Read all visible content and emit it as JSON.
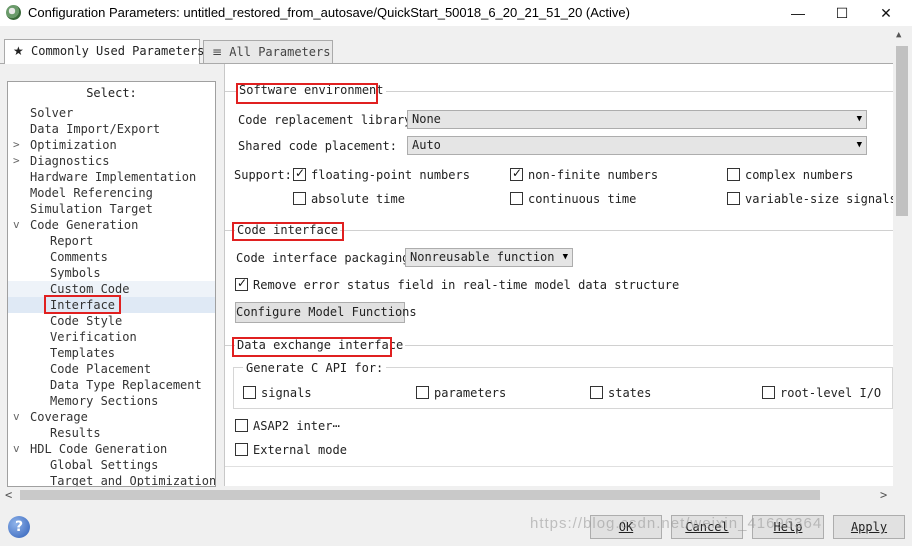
{
  "window": {
    "title": "Configuration Parameters: untitled_restored_from_autosave/QuickStart_50018_6_20_21_51_20 (Active)",
    "minimize": "—",
    "maximize": "☐",
    "close": "✕"
  },
  "tabs": [
    {
      "icon": "★",
      "label": "Commonly Used Parameters"
    },
    {
      "icon": "≡",
      "label": "All Parameters"
    }
  ],
  "tree": {
    "header": "Select:",
    "items": {
      "solver": "Solver",
      "data_io": "Data Import/Export",
      "optimization": "Optimization",
      "diagnostics": "Diagnostics",
      "hw_impl": "Hardware Implementation",
      "model_ref": "Model Referencing",
      "sim_target": "Simulation Target",
      "code_gen": "Code Generation",
      "report": "Report",
      "comments": "Comments",
      "symbols": "Symbols",
      "custom_code": "Custom Code",
      "interface": "Interface",
      "code_style": "Code Style",
      "verification": "Verification",
      "templates": "Templates",
      "code_placement": "Code Placement",
      "data_type_repl": "Data Type Replacement",
      "memory_sections": "Memory Sections",
      "coverage": "Coverage",
      "results": "Results",
      "hdl_code_gen": "HDL Code Generation",
      "global_settings": "Global Settings",
      "target_opt": "Target and Optimizations"
    },
    "expand_collapsed": ">",
    "expand_open": "v"
  },
  "software_env": {
    "title": "Software environment",
    "code_repl_label": "Code replacement library:",
    "code_repl_value": "None",
    "shared_label": "Shared code placement:",
    "shared_value": "Auto",
    "support_label": "Support:",
    "floating_point": "floating-point numbers",
    "non_finite": "non-finite numbers",
    "complex": "complex numbers",
    "absolute_time": "absolute time",
    "continuous_time": "continuous time",
    "variable_size": "variable-size signals"
  },
  "code_interface": {
    "title": "Code interface",
    "packaging_label": "Code interface packaging:",
    "packaging_value": "Nonreusable function",
    "remove_error": "Remove error status field in real-time model data structure",
    "configure_button": "Configure Model Functions"
  },
  "data_exchange": {
    "title": "Data exchange interface",
    "c_api_label": "Generate C API for:",
    "signals": "signals",
    "parameters": "parameters",
    "states": "states",
    "root_io": "root-level I/O",
    "asap2": "ASAP2 inter⋯",
    "external_mode": "External mode"
  },
  "scroll": {
    "up": "▲",
    "down": "▼",
    "left": "<",
    "right": ">"
  },
  "footer": {
    "help_icon": "?",
    "ok": "OK",
    "cancel": "Cancel",
    "help": "Help",
    "apply": "Apply",
    "watermark": "https://blog.csdn.net/weixin_41696364"
  },
  "colors": {
    "highlight_box": "#e02020",
    "selection": "#dfe9f5"
  }
}
